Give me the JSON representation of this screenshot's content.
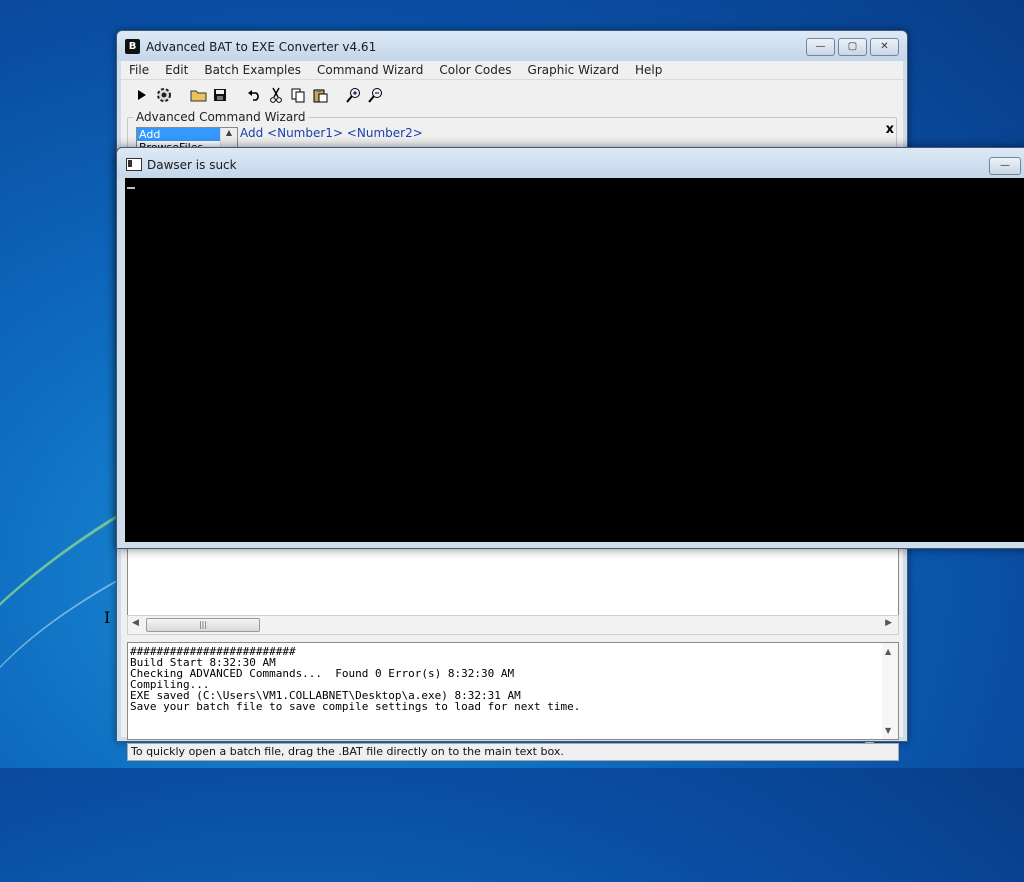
{
  "main_window": {
    "title": "Advanced BAT to EXE Converter v4.61",
    "controls": {
      "minimize": "—",
      "maximize": "▢",
      "close": "✕"
    },
    "menu": [
      "File",
      "Edit",
      "Batch Examples",
      "Command Wizard",
      "Color Codes",
      "Graphic Wizard",
      "Help"
    ],
    "wizard": {
      "label": "Advanced Command Wizard",
      "list_items": [
        "Add",
        "BrowseFiles"
      ],
      "selected": "Add",
      "syntax": "Add  <Number1> <Number2>",
      "close_glyph": "x"
    },
    "output_lines": [
      "#########################",
      "Build Start 8:32:30 AM",
      "Checking ADVANCED Commands...  Found 0 Error(s) 8:32:30 AM",
      "Compiling...",
      "EXE saved (C:\\Users\\VM1.COLLABNET\\Desktop\\a.exe) 8:32:31 AM",
      "Save your batch file to save compile settings to load for next time."
    ],
    "status": "To quickly open a batch file, drag the .BAT file directly on to the main text box."
  },
  "console_window": {
    "title": "Dawser is suck",
    "minimize": "—"
  },
  "icons": {
    "run": "play-icon",
    "compile": "gear-icon",
    "open": "folder-icon",
    "save": "disk-icon",
    "undo": "undo-icon",
    "cut": "scissors-icon",
    "copy": "copy-icon",
    "paste": "paste-icon",
    "zoom_in": "zoom-in-icon",
    "zoom_out": "zoom-out-icon"
  },
  "colors": {
    "selection": "#3399ff",
    "syntax_text": "#1a3fa8",
    "console_bg": "#000000"
  }
}
